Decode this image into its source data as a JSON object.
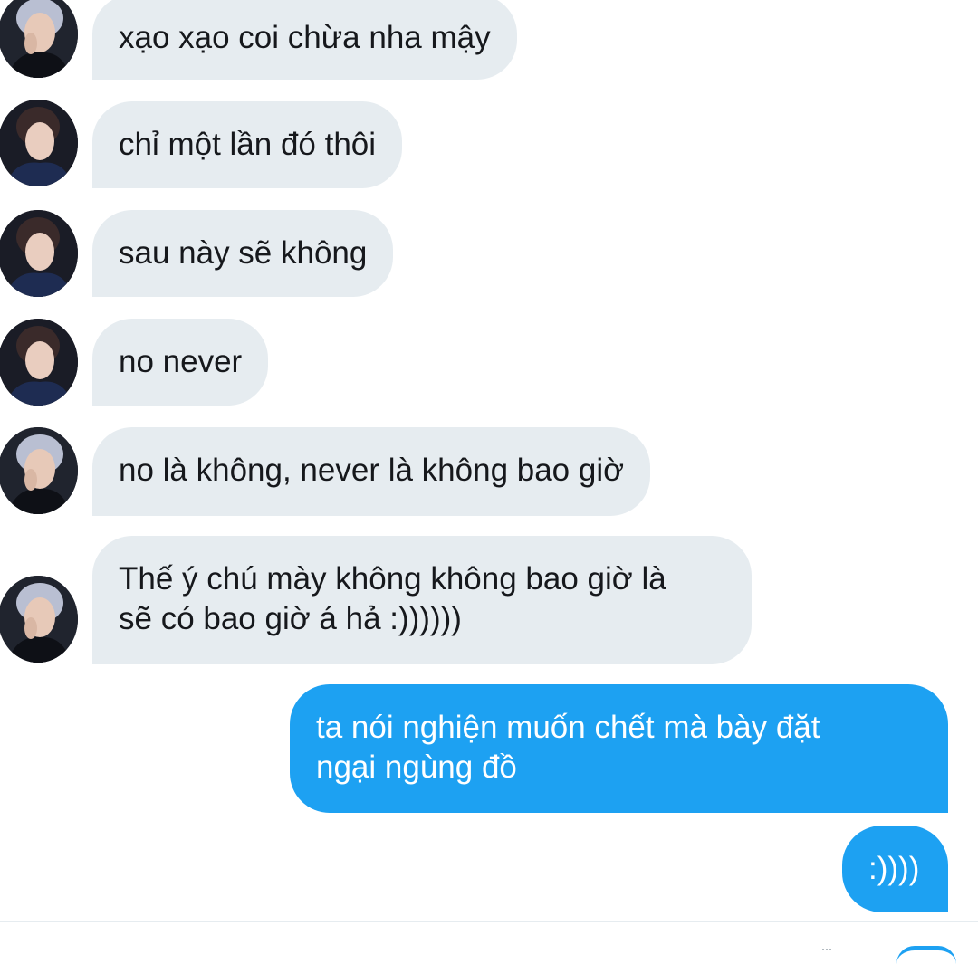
{
  "colors": {
    "incoming_bubble": "#e6ecf0",
    "outgoing_bubble": "#1da1f2",
    "incoming_text": "#16181c",
    "outgoing_text": "#ffffff"
  },
  "messages": [
    {
      "direction": "incoming",
      "avatar": "avatar-photo-silver-hair",
      "text": "xạo xạo coi chừa nha mậy"
    },
    {
      "direction": "incoming",
      "avatar": "avatar-photo-dark-hair",
      "text": "chỉ một lần đó thôi"
    },
    {
      "direction": "incoming",
      "avatar": "avatar-photo-dark-hair",
      "text": "sau này sẽ không"
    },
    {
      "direction": "incoming",
      "avatar": "avatar-photo-dark-hair",
      "text": "no never"
    },
    {
      "direction": "incoming",
      "avatar": "avatar-photo-silver-hair",
      "text": "no là không, never là không bao giờ"
    },
    {
      "direction": "incoming",
      "avatar": "avatar-photo-silver-hair",
      "lines": [
        "Thế ý chú mày không không bao giờ là",
        "sẽ có bao giờ á hả :))))))"
      ]
    },
    {
      "direction": "outgoing",
      "lines": [
        "ta nói nghiện muốn chết mà bày đặt",
        "ngại ngùng đồ"
      ]
    },
    {
      "direction": "outgoing",
      "text": ":))))"
    }
  ]
}
